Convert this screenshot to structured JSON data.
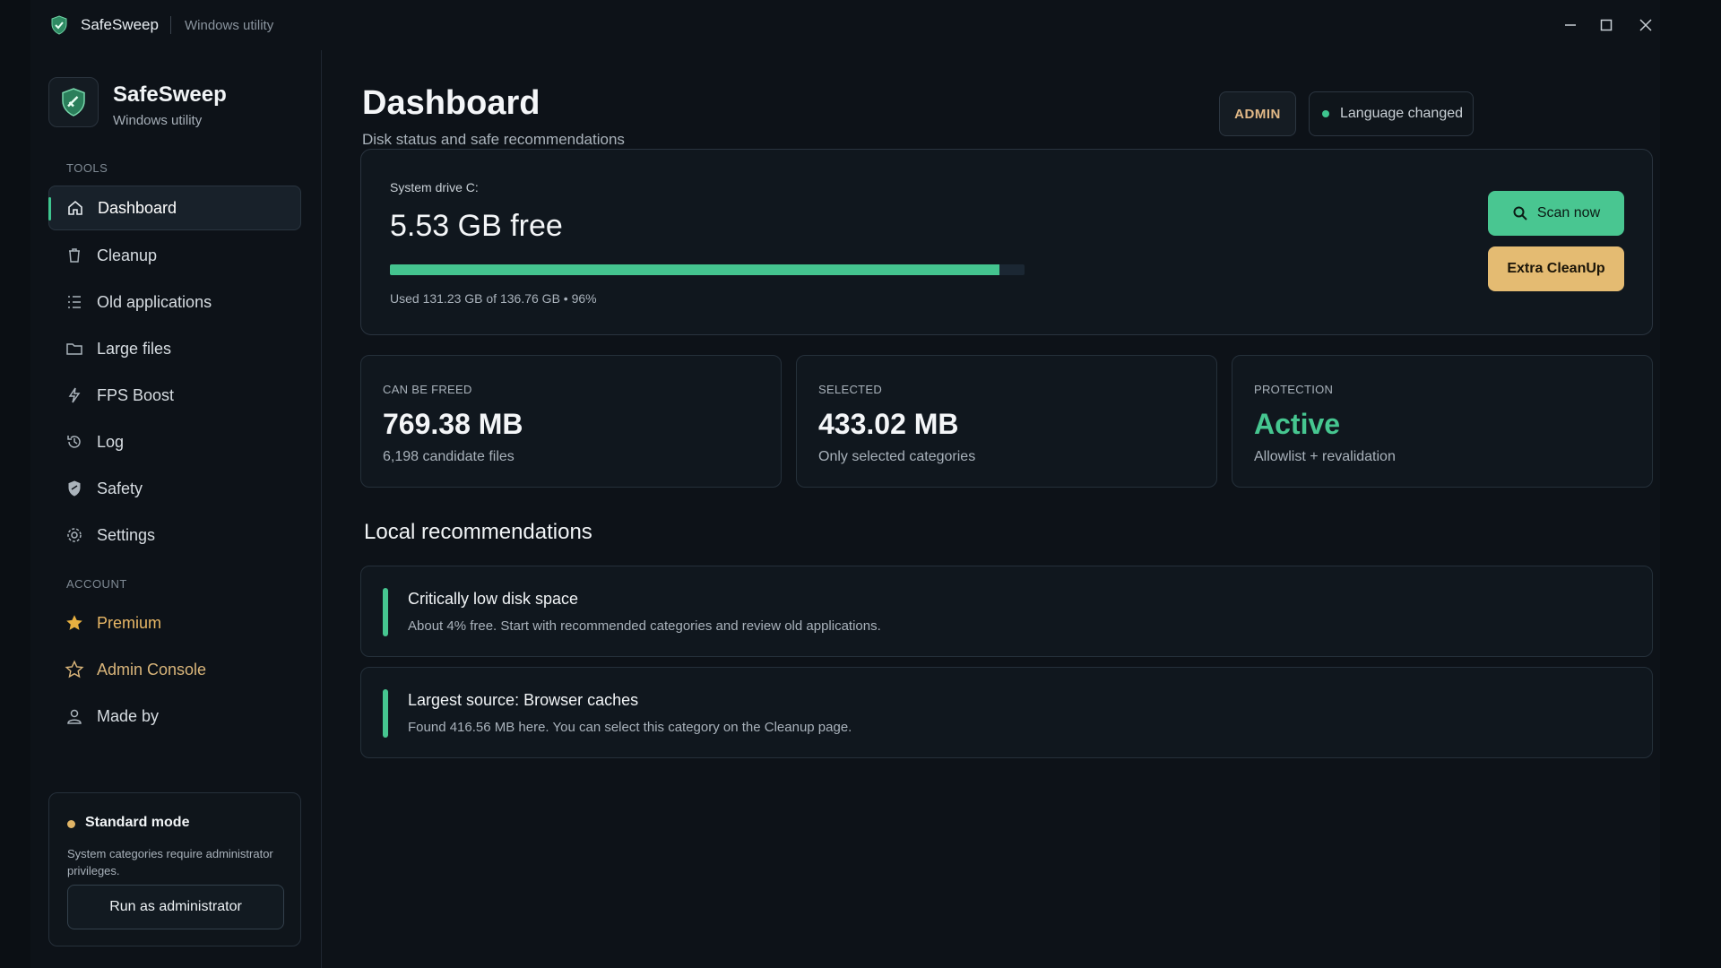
{
  "titlebar": {
    "app_name": "SafeSweep",
    "subtitle": "Windows utility"
  },
  "sidebar": {
    "brand_name": "SafeSweep",
    "brand_sub": "Windows utility",
    "tools_label": "TOOLS",
    "tools": [
      {
        "label": "Dashboard",
        "icon": "home-icon",
        "active": true
      },
      {
        "label": "Cleanup",
        "icon": "trash-icon"
      },
      {
        "label": "Old applications",
        "icon": "list-icon"
      },
      {
        "label": "Large files",
        "icon": "folder-icon"
      },
      {
        "label": "FPS Boost",
        "icon": "lightning-icon"
      },
      {
        "label": "Log",
        "icon": "history-icon"
      },
      {
        "label": "Safety",
        "icon": "shield-icon"
      },
      {
        "label": "Settings",
        "icon": "gear-icon"
      }
    ],
    "account_label": "ACCOUNT",
    "account": [
      {
        "label": "Premium",
        "icon": "star-filled-icon"
      },
      {
        "label": "Admin Console",
        "icon": "star-outline-icon"
      },
      {
        "label": "Made by",
        "icon": "user-icon"
      }
    ],
    "mode": {
      "title": "Standard mode",
      "desc": "System categories require administrator privileges.",
      "button": "Run as administrator"
    }
  },
  "main": {
    "title": "Dashboard",
    "subtitle": "Disk status and safe recommendations",
    "admin_badge": "ADMIN",
    "status": "Language changed",
    "drive": {
      "label": "System drive C:",
      "free": "5.53 GB free",
      "used_text": "Used 131.23 GB of 136.76 GB • 96%",
      "used_percent": 96
    },
    "scan_button": "Scan now",
    "extra_button": "Extra CleanUp",
    "stats": [
      {
        "label": "CAN BE FREED",
        "value": "769.38 MB",
        "desc": "6,198 candidate files"
      },
      {
        "label": "SELECTED",
        "value": "433.02 MB",
        "desc": "Only selected categories"
      },
      {
        "label": "PROTECTION",
        "value": "Active",
        "desc": "Allowlist + revalidation"
      }
    ],
    "rec_heading": "Local recommendations",
    "recommendations": [
      {
        "title": "Critically low disk space",
        "desc": "About 4% free. Start with recommended categories and review old applications."
      },
      {
        "title": "Largest source: Browser caches",
        "desc": "Found 416.56 MB here. You can select this category on the Cleanup page."
      }
    ]
  },
  "colors": {
    "accent_green": "#46c690",
    "accent_gold": "#e4bb72",
    "background": "#0d1218"
  }
}
